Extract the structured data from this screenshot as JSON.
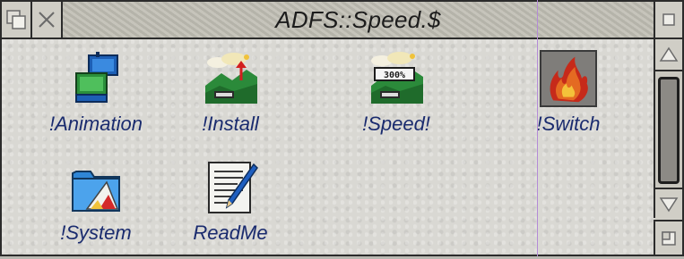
{
  "window": {
    "title": "ADFS::Speed.$"
  },
  "icons": [
    {
      "label": "!Animation",
      "icon": "animation-icon"
    },
    {
      "label": "!Install",
      "icon": "install-icon"
    },
    {
      "label": "!Speed!",
      "icon": "speed-icon",
      "badge": "300%"
    },
    {
      "label": "!Switch",
      "icon": "switch-icon",
      "selected": true
    },
    {
      "label": "!System",
      "icon": "system-icon"
    },
    {
      "label": "ReadMe",
      "icon": "readme-icon"
    }
  ],
  "colors": {
    "label_text": "#1a2b6e",
    "window_border": "#2b2b2b",
    "guide_line": "#b48ad6"
  }
}
